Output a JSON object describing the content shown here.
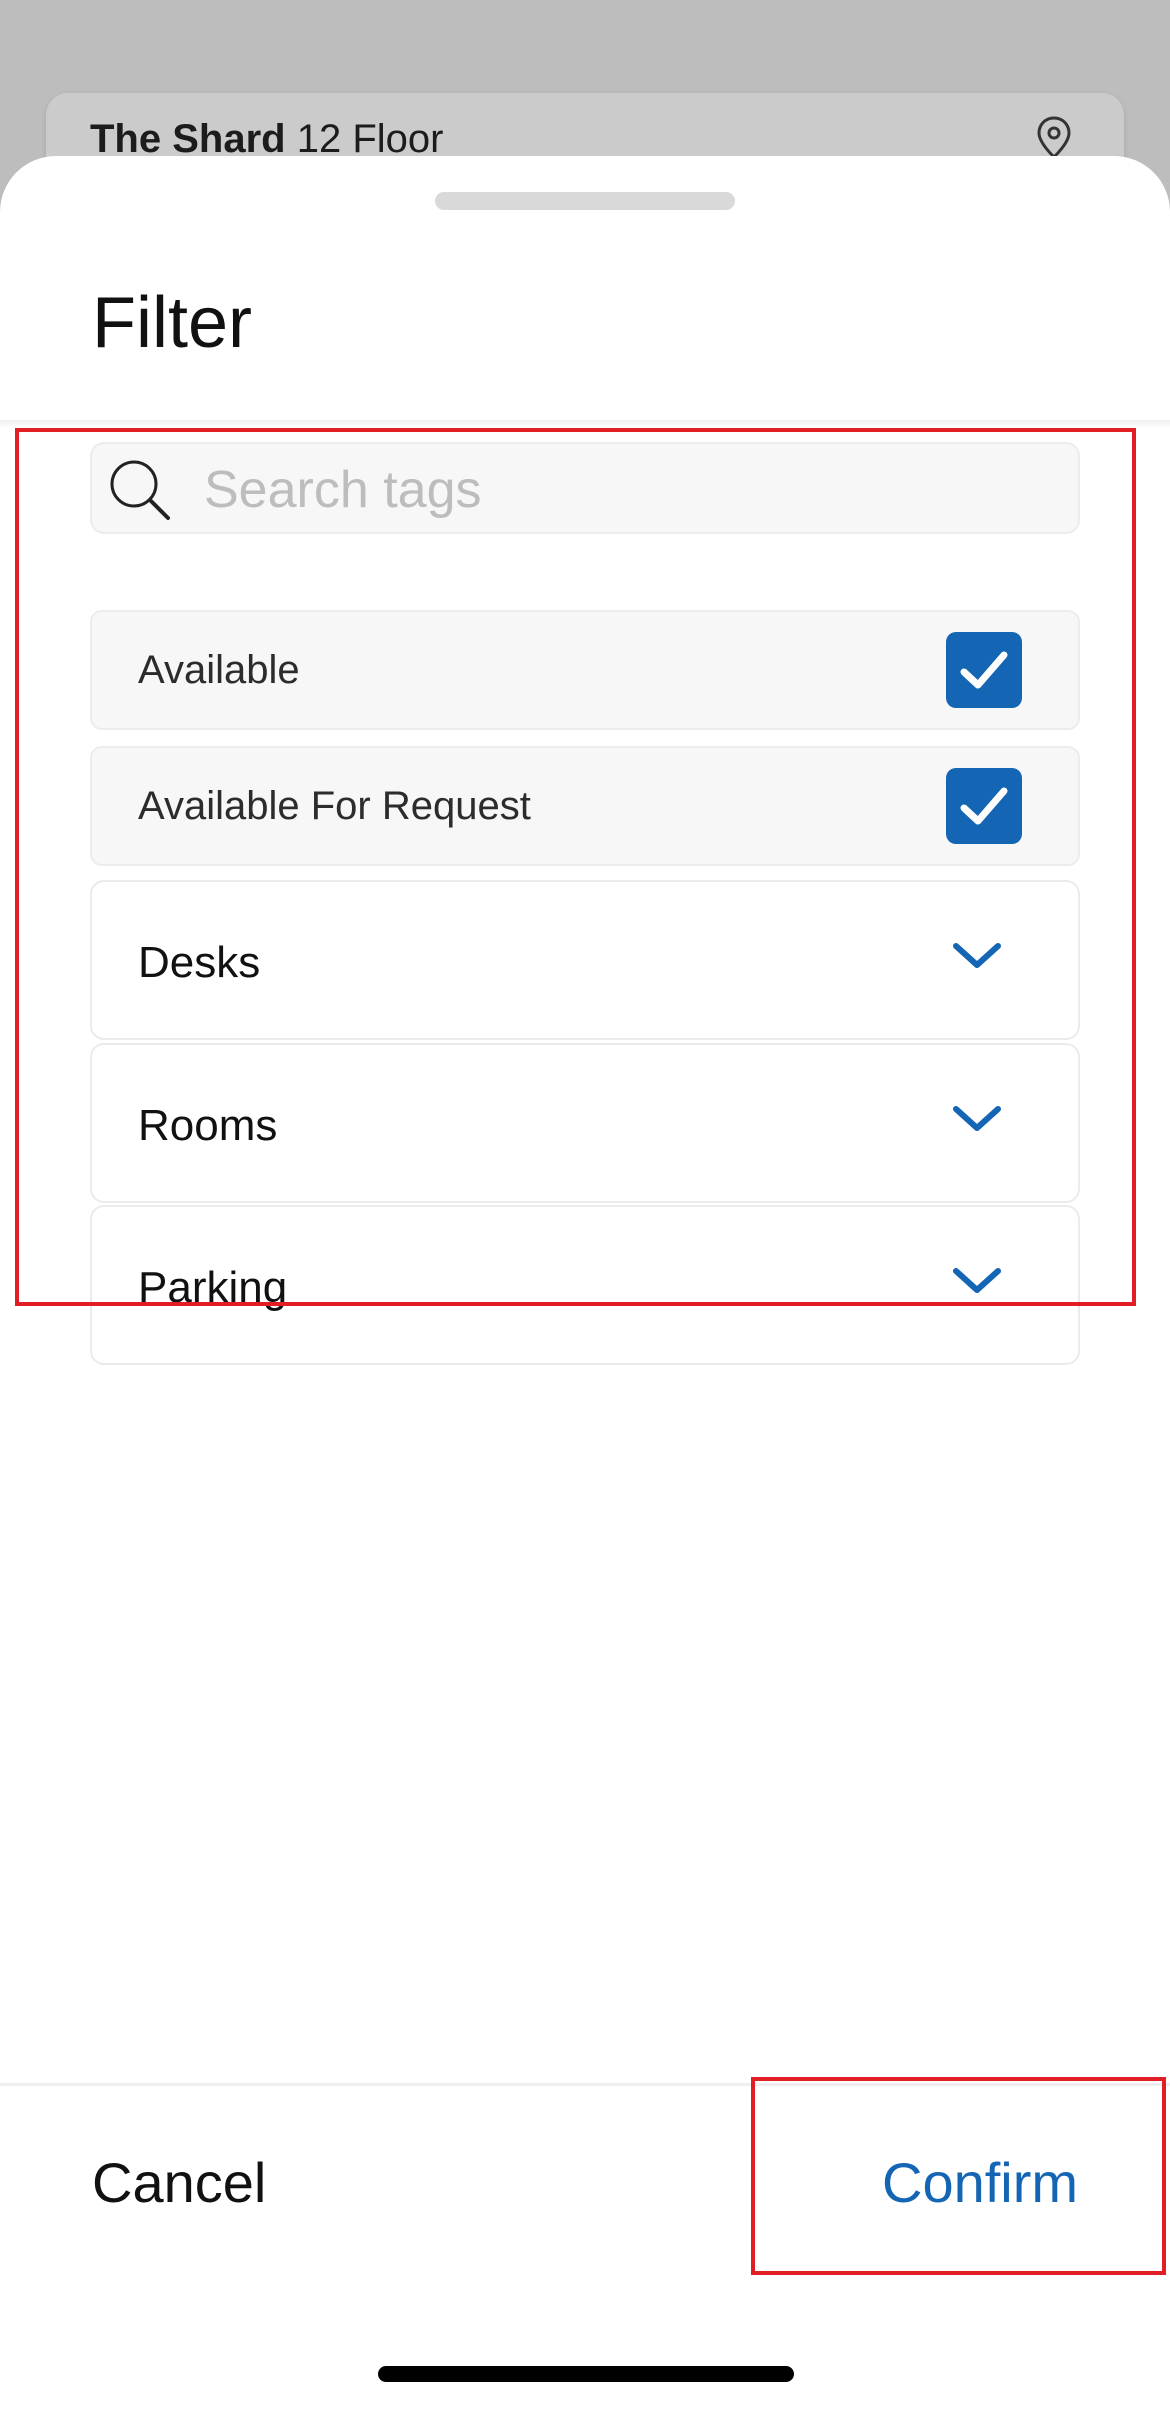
{
  "background_card": {
    "title_bold": "The Shard",
    "title_rest": " 12 Floor",
    "icon": "location-pin-icon"
  },
  "sheet": {
    "title": "Filter",
    "search": {
      "placeholder": "Search tags",
      "value": ""
    },
    "checkbox_rows": [
      {
        "label": "Available",
        "checked": true
      },
      {
        "label": "Available For Request",
        "checked": true
      }
    ],
    "accordion_rows": [
      {
        "label": "Desks",
        "icon": "chevron-down-icon"
      },
      {
        "label": "Rooms",
        "icon": "chevron-down-icon"
      },
      {
        "label": "Parking",
        "icon": "chevron-down-icon"
      }
    ]
  },
  "footer": {
    "cancel_label": "Cancel",
    "confirm_label": "Confirm"
  },
  "colors": {
    "accent": "#1565b5",
    "highlight_box": "#e11d25"
  }
}
